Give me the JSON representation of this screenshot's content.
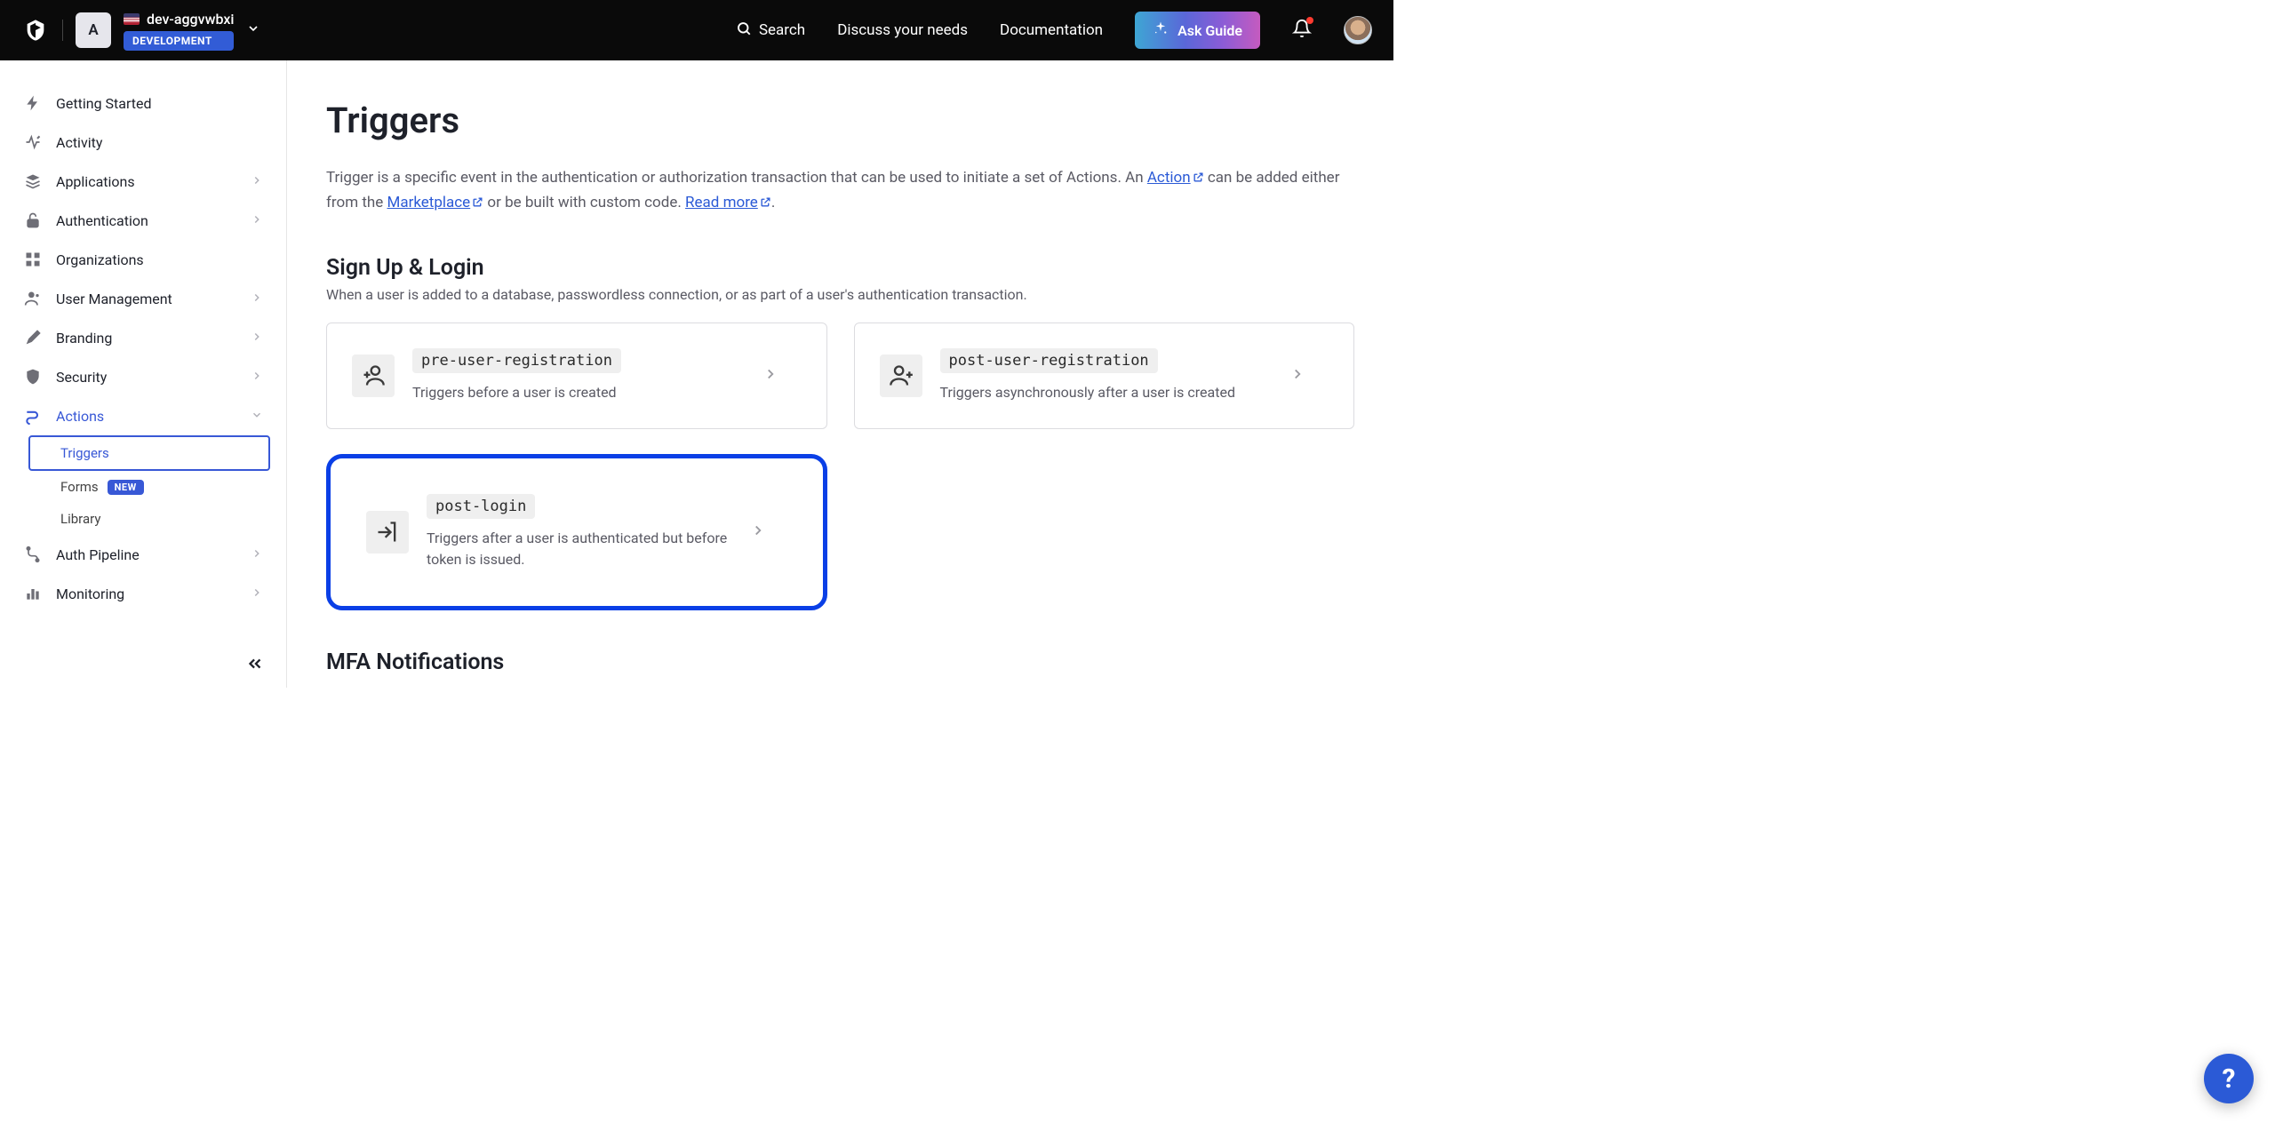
{
  "header": {
    "tenant_initial": "A",
    "tenant_name": "dev-aggvwbxi",
    "env_badge": "DEVELOPMENT",
    "search_label": "Search",
    "discuss_label": "Discuss your needs",
    "docs_label": "Documentation",
    "ask_guide_label": "Ask Guide"
  },
  "sidebar": {
    "items": [
      {
        "label": "Getting Started",
        "icon": "bolt",
        "expandable": false
      },
      {
        "label": "Activity",
        "icon": "activity",
        "expandable": false
      },
      {
        "label": "Applications",
        "icon": "layers",
        "expandable": true
      },
      {
        "label": "Authentication",
        "icon": "lock",
        "expandable": true
      },
      {
        "label": "Organizations",
        "icon": "grid",
        "expandable": false
      },
      {
        "label": "User Management",
        "icon": "user",
        "expandable": true
      },
      {
        "label": "Branding",
        "icon": "brush",
        "expandable": true
      },
      {
        "label": "Security",
        "icon": "shield",
        "expandable": true
      },
      {
        "label": "Actions",
        "icon": "flow",
        "expandable": true,
        "active": true
      },
      {
        "label": "Auth Pipeline",
        "icon": "pipeline",
        "expandable": true
      },
      {
        "label": "Monitoring",
        "icon": "bar-chart",
        "expandable": true
      }
    ],
    "actions_sub": [
      {
        "label": "Triggers",
        "selected": true
      },
      {
        "label": "Forms",
        "badge": "NEW"
      },
      {
        "label": "Library"
      }
    ]
  },
  "page": {
    "title": "Triggers",
    "desc_1": "Trigger is a specific event in the authentication or authorization transaction that can be used to initiate a set of Actions. An ",
    "link_action": "Action",
    "desc_2": " can be added either from the ",
    "link_marketplace": "Marketplace",
    "desc_3": " or be built with custom code. ",
    "link_readmore": "Read more",
    "section1_title": "Sign Up & Login",
    "section1_sub": "When a user is added to a database, passwordless connection, or as part of a user's authentication transaction.",
    "cards": {
      "pre_reg": {
        "tag": "pre-user-registration",
        "desc": "Triggers before a user is created"
      },
      "post_reg": {
        "tag": "post-user-registration",
        "desc": "Triggers asynchronously after a user is created"
      },
      "post_login": {
        "tag": "post-login",
        "desc": "Triggers after a user is authenticated but before token is issued."
      }
    },
    "section2_title": "MFA Notifications"
  },
  "help_fab": "?"
}
